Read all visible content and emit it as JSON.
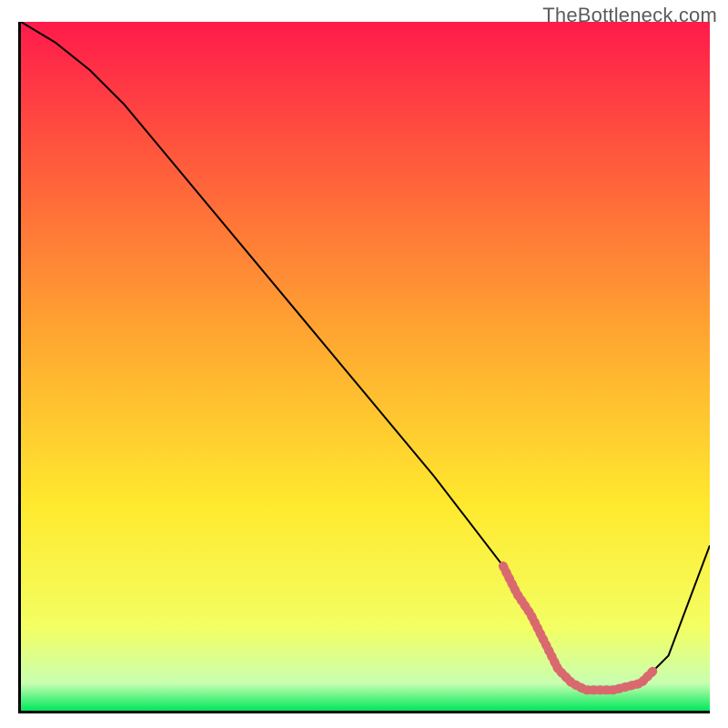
{
  "watermark": "TheBottleneck.com",
  "chart_data": {
    "type": "line",
    "title": "",
    "xlabel": "",
    "ylabel": "",
    "xlim": [
      0,
      100
    ],
    "ylim": [
      0,
      100
    ],
    "grid": false,
    "legend": false,
    "gradient_stops": [
      {
        "offset": 0,
        "color": "#ff1a4b"
      },
      {
        "offset": 20,
        "color": "#ff5a3c"
      },
      {
        "offset": 45,
        "color": "#ffa531"
      },
      {
        "offset": 70,
        "color": "#ffe92e"
      },
      {
        "offset": 88,
        "color": "#f3ff63"
      },
      {
        "offset": 96,
        "color": "#c9ffb0"
      },
      {
        "offset": 100,
        "color": "#00e85c"
      }
    ],
    "series": [
      {
        "name": "bottleneck-curve",
        "stroke": "#000000",
        "stroke_width": 2,
        "x": [
          0,
          5,
          10,
          15,
          20,
          30,
          40,
          50,
          60,
          70,
          74,
          78,
          82,
          86,
          90,
          94,
          100
        ],
        "y": [
          100,
          97,
          93,
          88,
          82,
          70,
          58,
          46,
          34,
          21,
          14,
          6,
          3,
          3,
          4,
          8,
          24
        ]
      },
      {
        "name": "optimal-range-marker",
        "stroke": "#d9696f",
        "stroke_width": 10,
        "dash": "2 5",
        "linecap": "round",
        "x": [
          70,
          72,
          74,
          76,
          78,
          80,
          82,
          84,
          86,
          88,
          90,
          92
        ],
        "y": [
          21,
          17,
          14,
          10,
          6,
          4,
          3,
          3,
          3,
          3.5,
          4,
          6
        ]
      }
    ]
  }
}
